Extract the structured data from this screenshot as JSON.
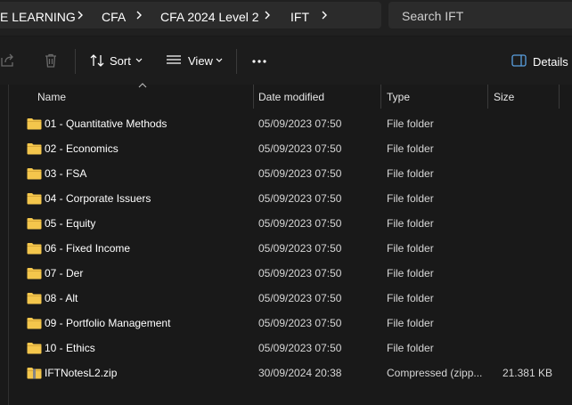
{
  "breadcrumb": {
    "items": [
      "E LEARNING",
      "CFA",
      "CFA 2024 Level 2",
      "IFT"
    ]
  },
  "search": {
    "placeholder": "Search IFT"
  },
  "toolbar": {
    "sort_label": "Sort",
    "view_label": "View",
    "details_label": "Details"
  },
  "columns": {
    "name": "Name",
    "date": "Date modified",
    "type": "Type",
    "size": "Size"
  },
  "files": [
    {
      "name": "01 - Quantitative Methods",
      "date": "05/09/2023 07:50",
      "type": "File folder",
      "size": "",
      "icon": "folder-icon"
    },
    {
      "name": "02 - Economics",
      "date": "05/09/2023 07:50",
      "type": "File folder",
      "size": "",
      "icon": "folder-icon"
    },
    {
      "name": "03 - FSA",
      "date": "05/09/2023 07:50",
      "type": "File folder",
      "size": "",
      "icon": "folder-icon"
    },
    {
      "name": "04 - Corporate Issuers",
      "date": "05/09/2023 07:50",
      "type": "File folder",
      "size": "",
      "icon": "folder-icon"
    },
    {
      "name": "05 - Equity",
      "date": "05/09/2023 07:50",
      "type": "File folder",
      "size": "",
      "icon": "folder-icon"
    },
    {
      "name": "06 - Fixed Income",
      "date": "05/09/2023 07:50",
      "type": "File folder",
      "size": "",
      "icon": "folder-icon"
    },
    {
      "name": "07 - Der",
      "date": "05/09/2023 07:50",
      "type": "File folder",
      "size": "",
      "icon": "folder-icon"
    },
    {
      "name": "08 - Alt",
      "date": "05/09/2023 07:50",
      "type": "File folder",
      "size": "",
      "icon": "folder-icon"
    },
    {
      "name": "09 - Portfolio Management",
      "date": "05/09/2023 07:50",
      "type": "File folder",
      "size": "",
      "icon": "folder-icon"
    },
    {
      "name": "10 - Ethics",
      "date": "05/09/2023 07:50",
      "type": "File folder",
      "size": "",
      "icon": "folder-icon"
    },
    {
      "name": "IFTNotesL2.zip",
      "date": "30/09/2024 20:38",
      "type": "Compressed (zipp...",
      "size": "21.381 KB",
      "icon": "zip-folder-icon"
    }
  ],
  "colors": {
    "background": "#191919",
    "toolbar": "#1c1c1c",
    "field": "#2b2b2b",
    "folder": "#f4c64c",
    "text": "#ffffff",
    "muted": "#d6d6d6"
  }
}
